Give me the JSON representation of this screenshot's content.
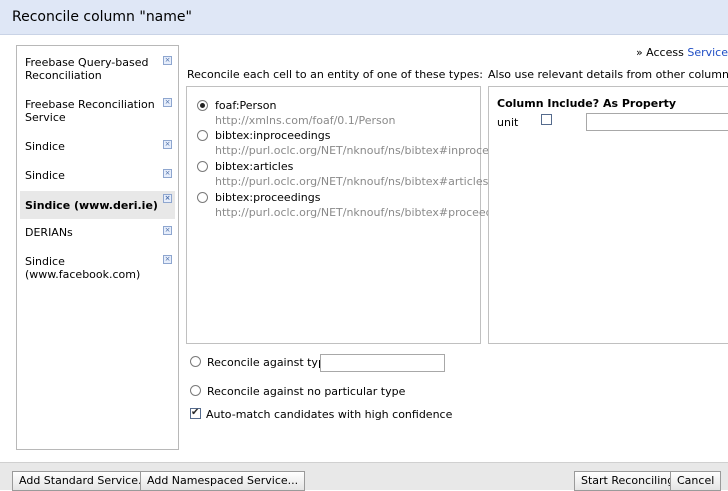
{
  "dialog": {
    "title": "Reconcile column \"name\""
  },
  "services": [
    {
      "label": "Freebase Query-based Reconciliation",
      "selected": false
    },
    {
      "label": "Freebase Reconciliation Service",
      "selected": false
    },
    {
      "label": "Sindice",
      "selected": false
    },
    {
      "label": "Sindice",
      "selected": false
    },
    {
      "label": "Sindice (www.deri.ie)",
      "selected": true
    },
    {
      "label": "DERIANs",
      "selected": false
    },
    {
      "label": "Sindice (www.facebook.com)",
      "selected": false
    }
  ],
  "remove_icon_glyph": "×",
  "access": {
    "prefix": "» Access",
    "service": "Service"
  },
  "types_section": {
    "label": "Reconcile each cell to an entity of one of these types:",
    "types": [
      {
        "name": "foaf:Person",
        "url": "http://xmlns.com/foaf/0.1/Person",
        "selected": true
      },
      {
        "name": "bibtex:inproceedings",
        "url": "http://purl.oclc.org/NET/nknouf/ns/bibtex#inproceedings",
        "selected": false
      },
      {
        "name": "bibtex:articles",
        "url": "http://purl.oclc.org/NET/nknouf/ns/bibtex#articles",
        "selected": false
      },
      {
        "name": "bibtex:proceedings",
        "url": "http://purl.oclc.org/NET/nknouf/ns/bibtex#proceedings",
        "selected": false
      }
    ]
  },
  "columns_section": {
    "label": "Also use relevant details from other columns:",
    "header": "Column Include? As Property",
    "rows": [
      {
        "column": "unit",
        "include": false,
        "property": ""
      }
    ]
  },
  "options": {
    "against_type": {
      "label": "Reconcile against type:",
      "value": "",
      "selected": false
    },
    "no_type": {
      "label": "Reconcile against no particular type",
      "selected": false
    },
    "auto_match": {
      "label": "Auto-match candidates with high confidence",
      "checked": true
    }
  },
  "footer": {
    "add_standard": "Add Standard Service...",
    "add_namespaced": "Add Namespaced Service...",
    "start": "Start Reconciling",
    "cancel": "Cancel"
  }
}
